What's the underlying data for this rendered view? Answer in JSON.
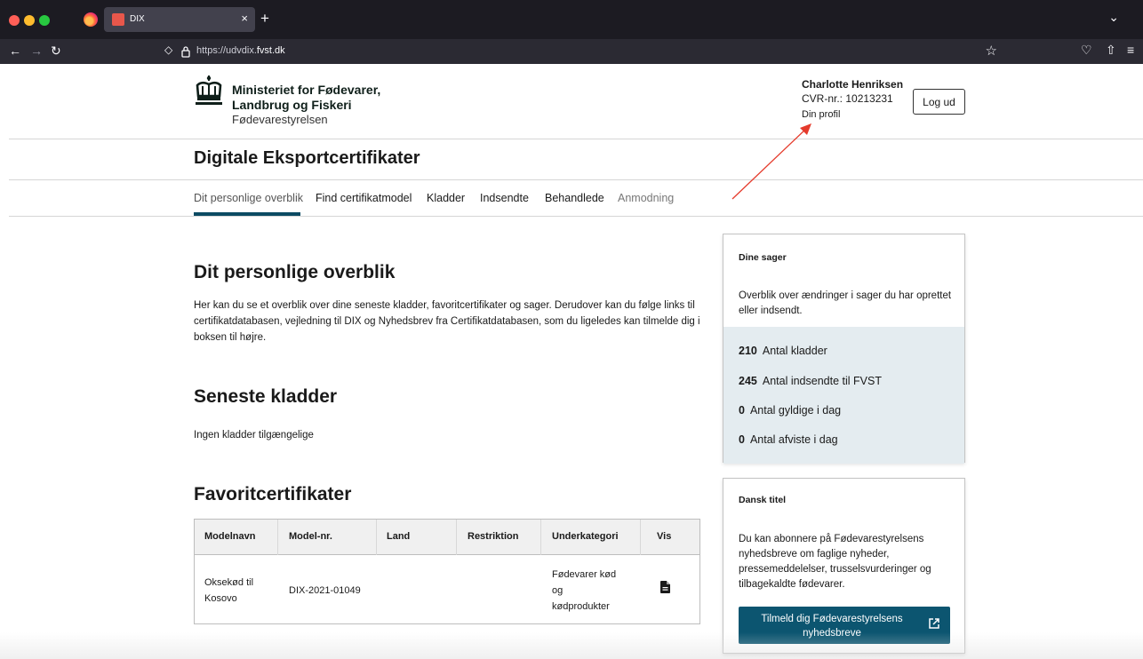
{
  "browser": {
    "tab_title": "DIX",
    "tab_close": "×",
    "new_tab": "+",
    "tabs_menu": "⌄",
    "url_prefix": "https://udvdix.",
    "url_domain": "fvst.dk",
    "colors": {
      "tabbar": "#1c1b22",
      "navbar": "#2b2a33",
      "close": "#ff5f57",
      "minimize": "#febc2e",
      "maximize": "#28c840"
    }
  },
  "header": {
    "logo_line1": "Ministeriet for Fødevarer,",
    "logo_line2": "Landbrug og Fiskeri",
    "logo_line3": "Fødevarestyrelsen",
    "user_name": "Charlotte Henriksen",
    "cvr": "CVR-nr.: 10213231",
    "profile_link": "Din profil",
    "logout_label": "Log ud"
  },
  "site_title": "Digitale Eksportcertifikater",
  "nav": {
    "items": [
      {
        "label": "Dit personlige overblik",
        "state": "active"
      },
      {
        "label": "Find certifikatmodel",
        "state": "normal"
      },
      {
        "label": "Kladder",
        "state": "normal"
      },
      {
        "label": "Indsendte",
        "state": "normal"
      },
      {
        "label": "Behandlede",
        "state": "normal"
      },
      {
        "label": "Anmodning",
        "state": "muted"
      }
    ],
    "accent_color": "#0c4b63"
  },
  "main": {
    "title": "Dit personlige overblik",
    "intro": "Her kan du se et overblik over dine seneste kladder, favoritcertifikater og sager. Derudover kan du følge links til certifikatdatabasen, vejledning til DIX og Nyhedsbrev fra Certifikatdatabasen, som du ligeledes kan tilmelde dig i boksen til højre.",
    "drafts_title": "Seneste kladder",
    "drafts_empty": "Ingen kladder tilgængelige",
    "favorites_title": "Favoritcertifikater",
    "favorites_table": {
      "columns": [
        "Modelnavn",
        "Model-nr.",
        "Land",
        "Restriktion",
        "Underkategori",
        "Vis"
      ],
      "rows": [
        {
          "modelnavn": [
            "Oksekød til",
            "Kosovo"
          ],
          "model_nr": "DIX-2021-01049",
          "land": "",
          "restriktion": "",
          "underkategori": [
            "Fødevarer kød",
            "og",
            "kødprodukter"
          ],
          "vis_icon": "document-icon"
        }
      ]
    }
  },
  "cases_box": {
    "title": "Dine sager",
    "description": "Overblik over ændringer i sager du har oprettet eller indsendt.",
    "stats": [
      {
        "value": "210",
        "label": "Antal kladder"
      },
      {
        "value": "245",
        "label": "Antal indsendte til FVST"
      },
      {
        "value": "0",
        "label": "Antal gyldige i dag"
      },
      {
        "value": "0",
        "label": "Antal afviste i dag"
      }
    ],
    "stats_bg": "#e4ecf0"
  },
  "newsletter_box": {
    "title": "Dansk titel",
    "description": "Du kan abonnere på Fødevarestyrelsens nyhedsbreve om faglige nyheder, pressemeddelelser, trusselsvurderinger og tilbagekaldte fødevarer.",
    "button_line1": "Tilmeld dig Fødevarestyrelsens",
    "button_line2": "nyhedsbreve",
    "button_icon": "external-link-icon",
    "button_color": "#0c5570"
  },
  "annotation": {
    "color": "#e53b2c",
    "icon": "arrow-annotation"
  }
}
